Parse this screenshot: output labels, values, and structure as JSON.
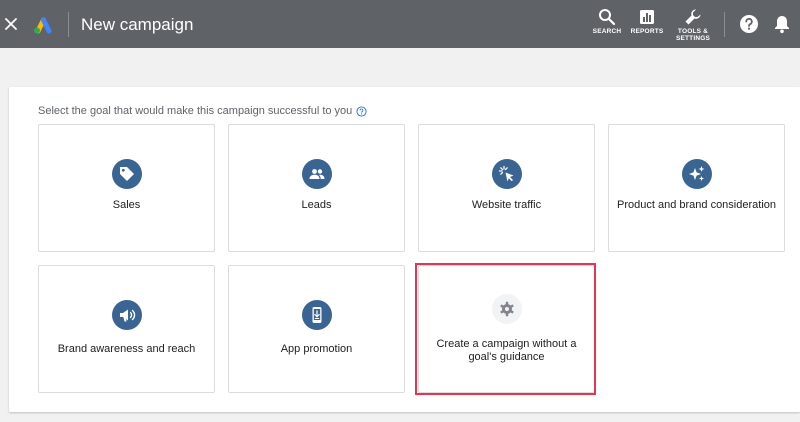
{
  "header": {
    "title": "New campaign",
    "tools": [
      {
        "label": "SEARCH",
        "icon": "search-icon"
      },
      {
        "label": "REPORTS",
        "icon": "reports-icon"
      },
      {
        "label": "TOOLS &\nSETTINGS",
        "icon": "wrench-icon"
      }
    ]
  },
  "main": {
    "prompt": "Select the goal that would make this campaign successful to you",
    "goals": [
      {
        "label": "Sales",
        "icon": "tag-icon"
      },
      {
        "label": "Leads",
        "icon": "people-icon"
      },
      {
        "label": "Website traffic",
        "icon": "cursor-click-icon"
      },
      {
        "label": "Product and brand consideration",
        "icon": "sparkle-icon"
      },
      {
        "label": "Brand awareness and reach",
        "icon": "megaphone-icon"
      },
      {
        "label": "App promotion",
        "icon": "phone-download-icon"
      },
      {
        "label": "Create a campaign without a goal's guidance",
        "icon": "gear-icon"
      }
    ]
  },
  "colors": {
    "topbar": "#5f6368",
    "goal_icon_bg": "#3a6593",
    "no_goal_icon_bg": "#f1f3f4",
    "highlight": "#e8344e"
  }
}
